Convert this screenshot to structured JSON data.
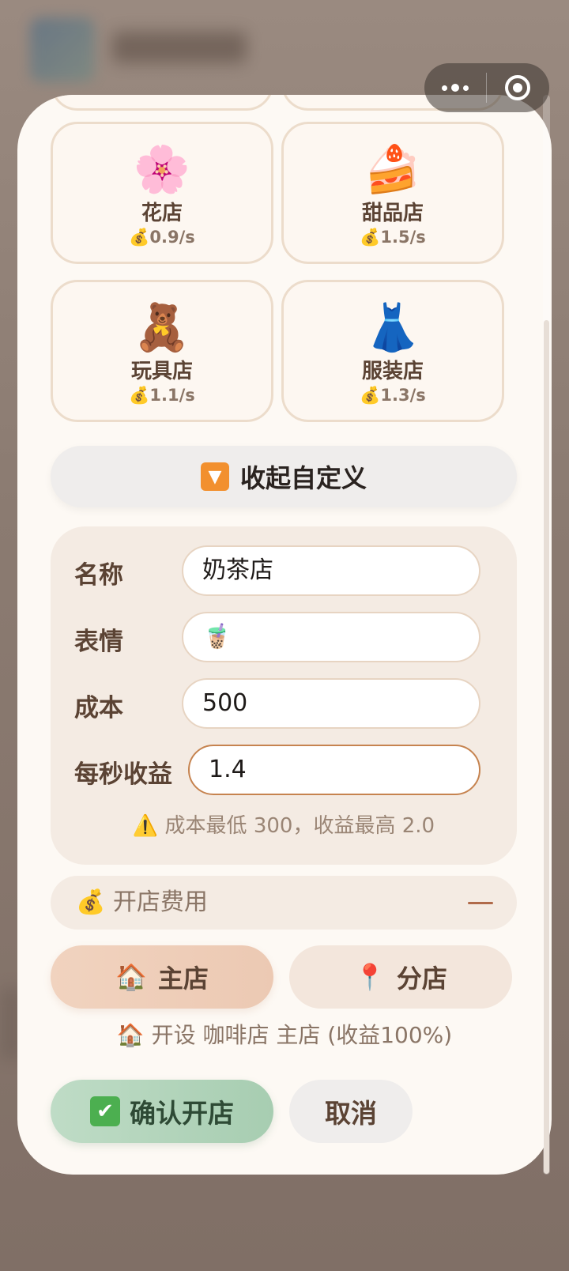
{
  "colors": {
    "modal_bg": "#fdf9f4",
    "accent_brown": "#5b4334",
    "card_border": "#ecdccb",
    "confirm_green": "#a7cdb1",
    "main_branch_peach": "#ecc9b3",
    "focus_border": "#c6834f"
  },
  "shops": [
    {
      "emoji": "🌸",
      "icon_name": "cherry-blossom-icon",
      "name": "花店",
      "income": "💰0.9/s"
    },
    {
      "emoji": "🍰",
      "icon_name": "cake-icon",
      "name": "甜品店",
      "income": "💰1.5/s"
    },
    {
      "emoji": "🧸",
      "icon_name": "teddy-bear-icon",
      "name": "玩具店",
      "income": "💰1.1/s"
    },
    {
      "emoji": "👗",
      "icon_name": "dress-icon",
      "name": "服装店",
      "income": "💰1.3/s"
    }
  ],
  "collapse": {
    "icon": "▼",
    "label": "收起自定义"
  },
  "form": {
    "name_label": "名称",
    "name_value": "奶茶店",
    "emoji_label": "表情",
    "emoji_value": "🧋",
    "cost_label": "成本",
    "cost_value": "500",
    "income_label": "每秒收益",
    "income_value": "1.4",
    "hint": "⚠️ 成本最低 300，收益最高 2.0"
  },
  "fee": {
    "label": "💰 开店费用"
  },
  "branch": {
    "main_icon": "🏠",
    "main_label": "主店",
    "sub_icon": "📍",
    "sub_label": "分店"
  },
  "open_info": "🏠 开设 咖啡店 主店 (收益100%)",
  "actions": {
    "confirm_icon": "✔",
    "confirm_label": "确认开店",
    "cancel_label": "取消"
  }
}
